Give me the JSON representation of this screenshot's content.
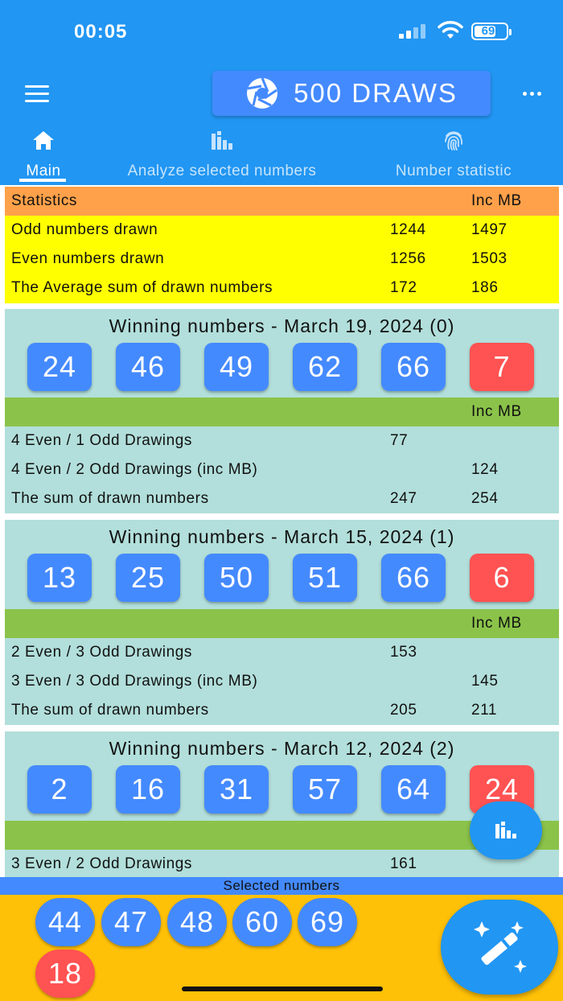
{
  "status_bar": {
    "time": "00:05",
    "battery": "69"
  },
  "app_bar": {
    "title": "500 DRAWS",
    "menu_icon": "hamburger-icon",
    "title_icon": "aperture-icon",
    "more_icon": "more-dots-icon"
  },
  "tabs": [
    {
      "label": "Main",
      "icon": "home-icon",
      "active": true
    },
    {
      "label": "Analyze selected numbers",
      "icon": "bar-chart-icon",
      "active": false
    },
    {
      "label": "Number statistic",
      "icon": "fingerprint-icon",
      "active": false
    }
  ],
  "statistics": {
    "header": {
      "label": "Statistics",
      "col3": "Inc MB"
    },
    "rows": [
      {
        "label": "Odd numbers drawn",
        "v1": "1244",
        "v2": "1497"
      },
      {
        "label": "Even numbers drawn",
        "v1": "1256",
        "v2": "1503"
      },
      {
        "label": "The Average sum of drawn numbers",
        "v1": "172",
        "v2": "186"
      }
    ]
  },
  "draws": [
    {
      "title": "Winning numbers - March 19, 2024 (0)",
      "numbers": [
        "24",
        "46",
        "49",
        "62",
        "66"
      ],
      "mega_ball": "7",
      "col3_header": "Inc MB",
      "rows": [
        {
          "label": "4 Even / 1 Odd Drawings",
          "v1": "77",
          "v2": ""
        },
        {
          "label": "4 Even / 2 Odd Drawings (inc MB)",
          "v1": "",
          "v2": "124"
        },
        {
          "label": "The sum of drawn numbers",
          "v1": "247",
          "v2": "254"
        }
      ]
    },
    {
      "title": "Winning numbers - March 15, 2024 (1)",
      "numbers": [
        "13",
        "25",
        "50",
        "51",
        "66"
      ],
      "mega_ball": "6",
      "col3_header": "Inc MB",
      "rows": [
        {
          "label": "2 Even / 3 Odd Drawings",
          "v1": "153",
          "v2": ""
        },
        {
          "label": "3 Even / 3 Odd Drawings (inc MB)",
          "v1": "",
          "v2": "145"
        },
        {
          "label": "The sum of drawn numbers",
          "v1": "205",
          "v2": "211"
        }
      ]
    },
    {
      "title": "Winning numbers - March 12, 2024 (2)",
      "numbers": [
        "2",
        "16",
        "31",
        "57",
        "64"
      ],
      "mega_ball": "24",
      "col3_header": "",
      "rows": [
        {
          "label": "3 Even / 2 Odd Drawings",
          "v1": "161",
          "v2": ""
        }
      ]
    }
  ],
  "selected": {
    "title": "Selected numbers",
    "numbers": [
      "44",
      "47",
      "48",
      "60",
      "69"
    ],
    "mega_ball": "18"
  },
  "fabs": {
    "small_icon": "bar-chart-icon",
    "big_icon": "magic-wand-icon"
  },
  "colors": {
    "primary": "#2196f3",
    "ball_blue": "#448aff",
    "ball_red": "#ff5252",
    "stats_header": "#ffa14a",
    "stats_rows": "#ffff00",
    "card_bg": "#b2dfdb",
    "card_bar": "#8bc34a",
    "selected_bg": "#ffc107"
  }
}
